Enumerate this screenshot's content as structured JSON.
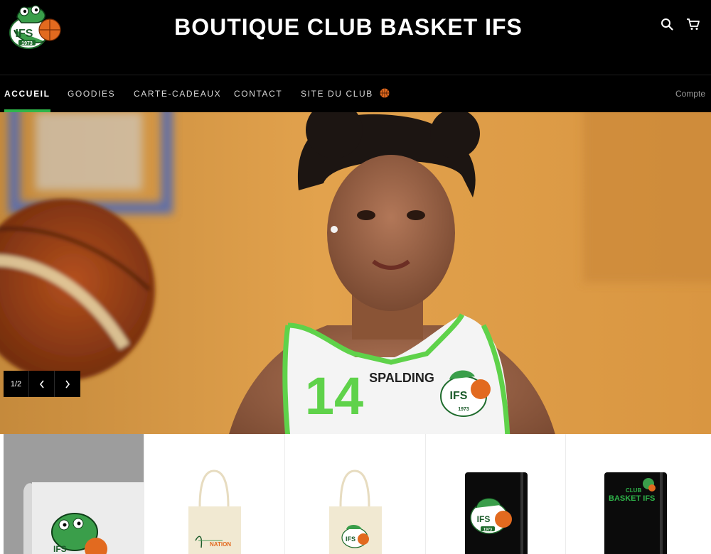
{
  "header": {
    "title": "BOUTIQUE CLUB BASKET IFS",
    "logo_text": "IFS",
    "logo_year": "1973",
    "search_icon": "search-icon",
    "cart_icon": "cart-icon"
  },
  "nav": {
    "items": [
      {
        "label": "ACCUEIL",
        "active": true
      },
      {
        "label": "GOODIES",
        "active": false
      },
      {
        "label": "CARTE-CADEAUX",
        "active": false
      },
      {
        "label": "CONTACT",
        "active": false
      },
      {
        "label": "SITE DU CLUB",
        "active": false,
        "icon": "basketball-icon"
      }
    ],
    "account": "Compte"
  },
  "hero": {
    "jersey_number": "14",
    "jersey_brand": "SPALDING",
    "jersey_logo_text": "IFS",
    "jersey_logo_year": "1973",
    "slide_counter": "1/2",
    "prev_icon": "chevron-left-icon",
    "next_icon": "chevron-right-icon"
  },
  "products": [
    {
      "name": "mug",
      "logo_text": "IFS"
    },
    {
      "name": "tote-bag-nation",
      "print_text": "NATION"
    },
    {
      "name": "tote-bag-logo",
      "logo_text": "IFS"
    },
    {
      "name": "notebook-logo",
      "logo_text": "IFS",
      "logo_year": "1973"
    },
    {
      "name": "notebook-club-basket",
      "print_text_1": "CLUB",
      "print_text_2": "BASKET IFS"
    }
  ],
  "colors": {
    "brand_green": "#2fb54a",
    "header_bg": "#000000",
    "ball_orange": "#e26a1f"
  }
}
